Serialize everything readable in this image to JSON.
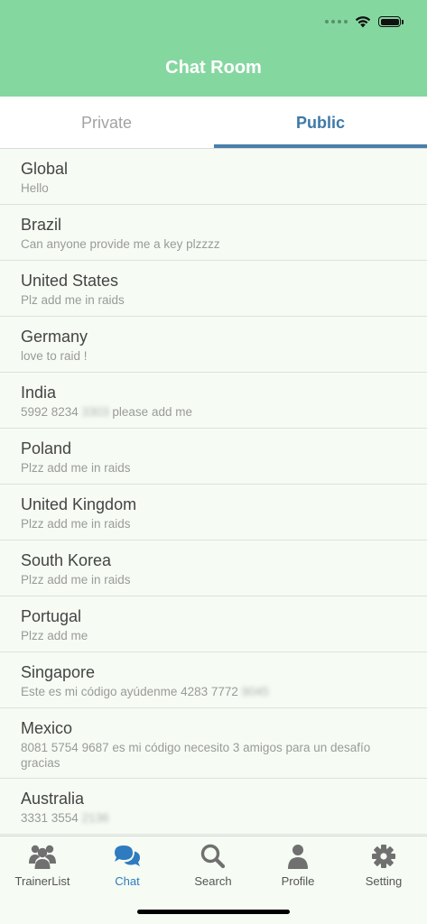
{
  "header": {
    "title": "Chat Room",
    "accent": "#85d7a0"
  },
  "tabs": {
    "private": "Private",
    "public": "Public",
    "active": "Public"
  },
  "rooms": [
    {
      "name": "Global",
      "msg": "Hello",
      "msg_blur": ""
    },
    {
      "name": "Brazil",
      "msg": "Can anyone provide me a key plzzzz",
      "msg_blur": ""
    },
    {
      "name": "United States",
      "msg": "Plz add me in raids",
      "msg_blur": ""
    },
    {
      "name": "Germany",
      "msg": "love to raid !",
      "msg_blur": ""
    },
    {
      "name": "India",
      "msg": "5992 8234",
      "msg_blur": "3303",
      "msg_after": "please add me"
    },
    {
      "name": "Poland",
      "msg": "Plzz add me in raids",
      "msg_blur": ""
    },
    {
      "name": "United Kingdom",
      "msg": "Plzz add me in raids",
      "msg_blur": ""
    },
    {
      "name": "South Korea",
      "msg": "Plzz add me in raids",
      "msg_blur": ""
    },
    {
      "name": "Portugal",
      "msg": "Plzz add me",
      "msg_blur": ""
    },
    {
      "name": "Singapore",
      "msg": "Este es mi código ayúdenme 4283 7772",
      "msg_blur": "9045"
    },
    {
      "name": "Mexico",
      "msg": "8081 5754 9687 es mi código necesito 3 amigos para un desafío gracias",
      "msg_blur": ""
    },
    {
      "name": "Australia",
      "msg": "3331 3554",
      "msg_blur": "2136"
    }
  ],
  "tabbar": [
    {
      "label": "TrainerList",
      "icon": "users-icon"
    },
    {
      "label": "Chat",
      "icon": "chat-icon",
      "active": true
    },
    {
      "label": "Search",
      "icon": "search-icon"
    },
    {
      "label": "Profile",
      "icon": "user-icon"
    },
    {
      "label": "Setting",
      "icon": "gear-icon"
    }
  ],
  "colors": {
    "active_tab": "#3d79a8",
    "tabbar_active": "#2e7bbf",
    "inactive": "#a3a3a3"
  }
}
